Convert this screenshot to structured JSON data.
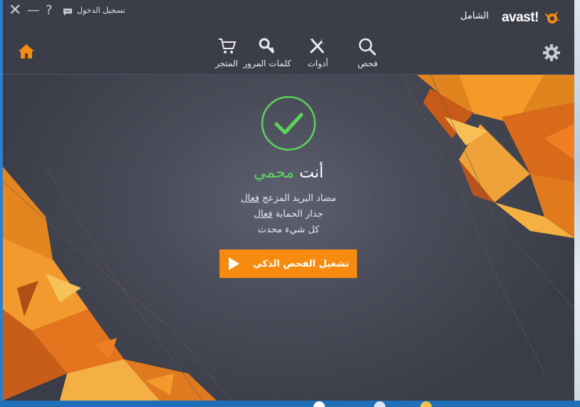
{
  "colors": {
    "accent": "#f78b10",
    "protected_green": "#5bd35b",
    "window_bg": "#3b3d48"
  },
  "titlebar": {
    "login": "تسجيل الدخول",
    "close_icon": "close-icon",
    "minimize_icon": "minimize-icon",
    "help": "?",
    "chat_icon": "chat-icon"
  },
  "brand": {
    "logo": "avast!",
    "edition": "الشامل"
  },
  "nav": {
    "home_icon": "home-icon",
    "scan": "فحص",
    "tools": "أدوات",
    "passwords": "كلمات المرور",
    "store": "المتجر",
    "settings_icon": "gear-icon"
  },
  "main": {
    "status_prefix": "أنت",
    "status_word": "محمي",
    "lines": [
      {
        "label": "مضاد البريد المزعج",
        "value": "فعال"
      },
      {
        "label": "جدار الحماية",
        "value": "فعال"
      },
      {
        "label": "كل شيء محدث",
        "value": ""
      }
    ],
    "scan_button": "تشغيل الفحص الذكي"
  }
}
